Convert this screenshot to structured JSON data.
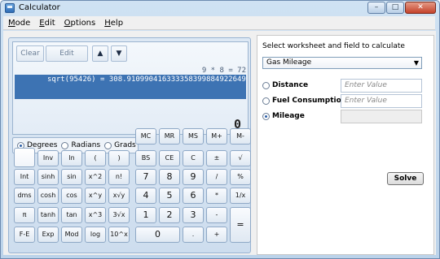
{
  "window": {
    "title": "Calculator",
    "controls": {
      "minimize": "–",
      "maximize": "□",
      "close": "✕"
    }
  },
  "menu": [
    {
      "underlined": "M",
      "rest": "ode"
    },
    {
      "underlined": "E",
      "rest": "dit"
    },
    {
      "underlined": "O",
      "rest": "ptions"
    },
    {
      "underlined": "H",
      "rest": "elp"
    }
  ],
  "history": {
    "clear_label": "Clear",
    "edit_label": "Edit",
    "up_icon": "up-arrow-icon",
    "down_icon": "down-arrow-icon",
    "line1": "9 * 8 = 72",
    "line2": "sqrt(95426) = 308.91099041633335839988492264952"
  },
  "display": {
    "value": "0"
  },
  "angle_units": {
    "options": [
      "Degrees",
      "Radians",
      "Grads"
    ],
    "selected": "Degrees"
  },
  "keys": {
    "row0": [
      "MC",
      "MR",
      "MS",
      "M+",
      "M-"
    ],
    "row1": [
      "",
      "Inv",
      "ln",
      "(",
      ")",
      "BS",
      "CE",
      "C",
      "±",
      "√"
    ],
    "row2": [
      "Int",
      "sinh",
      "sin",
      "x^2",
      "n!",
      "7",
      "8",
      "9",
      "/",
      "%"
    ],
    "row3": [
      "dms",
      "cosh",
      "cos",
      "x^y",
      "x√y",
      "4",
      "5",
      "6",
      "*",
      "1/x"
    ],
    "row4": [
      "π",
      "tanh",
      "tan",
      "x^3",
      "3√x",
      "1",
      "2",
      "3",
      "-",
      "="
    ],
    "row5": [
      "F-E",
      "Exp",
      "Mod",
      "log",
      "10^x",
      "0",
      ".",
      "+"
    ]
  },
  "worksheet": {
    "heading": "Select worksheet and field to calculate",
    "selected_worksheet": "Gas Mileage",
    "fields": [
      {
        "label": "Distance",
        "placeholder": "Enter Value",
        "selected": false
      },
      {
        "label": "Fuel Consumption",
        "placeholder": "Enter Value",
        "selected": false
      },
      {
        "label": "Mileage",
        "placeholder": "",
        "selected": true
      }
    ],
    "solve_label": "Solve"
  }
}
